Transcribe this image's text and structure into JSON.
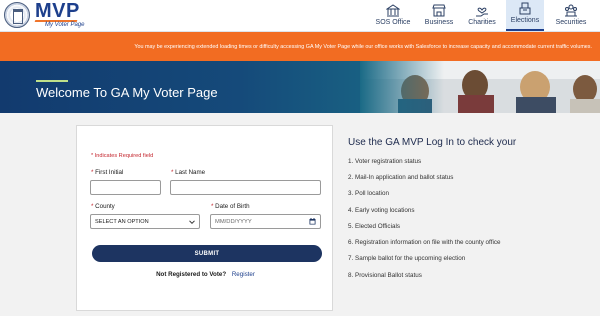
{
  "header": {
    "logo_text": "MVP",
    "logo_subtitle": "My Voter Page",
    "nav": [
      {
        "label": "SOS Office",
        "icon": "building-icon"
      },
      {
        "label": "Business",
        "icon": "store-icon"
      },
      {
        "label": "Charities",
        "icon": "hand-heart-icon"
      },
      {
        "label": "Elections",
        "icon": "ballot-box-icon",
        "active": true
      },
      {
        "label": "Securities",
        "icon": "people-icon"
      }
    ]
  },
  "alert": {
    "text": "You may be experiencing extended loading times or difficulty accessing GA My Voter Page while our office works with Salesforce to increase capacity and accommodate current traffic volumes."
  },
  "hero": {
    "title": "Welcome To GA My Voter Page"
  },
  "form": {
    "required_note": "* Indicates Required field",
    "first_initial": {
      "star": "*",
      "label": "First Initial",
      "value": ""
    },
    "last_name": {
      "star": "*",
      "label": "Last Name",
      "value": ""
    },
    "county": {
      "star": "*",
      "label": "County",
      "selected": "SELECT AN OPTION"
    },
    "dob": {
      "star": "*",
      "label": "Date of Birth",
      "placeholder": "MM/DD/YYYY"
    },
    "submit_label": "SUBMIT",
    "register_question": "Not Registered to Vote?",
    "register_link": "Register"
  },
  "info": {
    "title": "Use the GA MVP Log In to check your",
    "items": [
      "1. Voter registration status",
      "2. Mail-In application and ballot status",
      "3. Poll location",
      "4. Early voting locations",
      "5. Elected Officials",
      "6. Registration information on file with the county office",
      "7. Sample ballot for the upcoming election",
      "8. Provisional Ballot status"
    ]
  },
  "colors": {
    "brand_navy": "#1d3461",
    "alert_orange": "#f26c22",
    "required_red": "#c4262e",
    "link_blue": "#1d3f8c"
  }
}
